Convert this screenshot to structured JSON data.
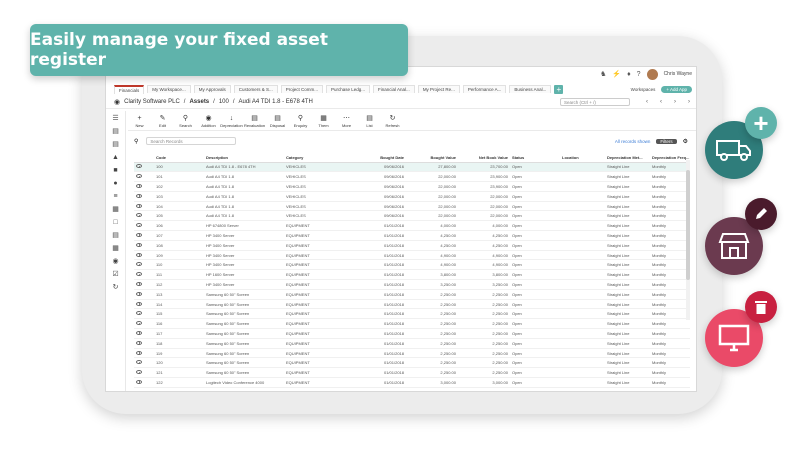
{
  "banner": {
    "text": "Easily manage your fixed asset register"
  },
  "topbar": {
    "user": "Chris Wayne"
  },
  "tabs": {
    "items": [
      "Financials",
      "My Workspace...",
      "My Approvals",
      "Customers & S...",
      "Project Comm...",
      "Purchase Ledg...",
      "Financial Anal...",
      "My Project Re...",
      "Performance A...",
      "Business Anal..."
    ],
    "workspaces": "Workspaces",
    "add_app": "+ Add App"
  },
  "breadcrumb": {
    "company": "Clarity Software PLC",
    "section": "Assets",
    "asset_code": "100",
    "asset_name": "Audi A4 TDI 1.8 - E678 4TH",
    "search_placeholder": "Search (Ctrl + /)"
  },
  "toolbar": {
    "items": [
      "New",
      "Edit",
      "Search",
      "Addition",
      "Depreciation",
      "Revaluation",
      "Disposal",
      "Enquiry",
      "Them",
      "More",
      "List",
      "Refresh"
    ]
  },
  "grid_search": {
    "placeholder": "Search Records",
    "advanced": "All records shown",
    "filter": "Filters"
  },
  "grid": {
    "headers": [
      "",
      "Code",
      "Description",
      "Category",
      "Bought Date",
      "Bought Value",
      "Net Book Value",
      "Status",
      "Location",
      "Depreciation Met...",
      "Depreciation Freq..."
    ],
    "rows": [
      {
        "code": "100",
        "desc": "Audi A4 TDI 1.8 - E678 4TH",
        "cat": "VEHICLES",
        "date": "09/06/2016",
        "value": "27,800.00",
        "nbv": "23,700.00",
        "status": "Open",
        "method": "Straight Line",
        "freq": "Monthly"
      },
      {
        "code": "101",
        "desc": "Audi A4 TDI 1.8",
        "cat": "VEHICLES",
        "date": "09/06/2016",
        "value": "22,000.00",
        "nbv": "23,900.00",
        "status": "Open",
        "method": "Straight Line",
        "freq": "Monthly"
      },
      {
        "code": "102",
        "desc": "Audi A4 TDI 1.8",
        "cat": "VEHICLES",
        "date": "09/06/2016",
        "value": "22,000.00",
        "nbv": "23,900.00",
        "status": "Open",
        "method": "Straight Line",
        "freq": "Monthly"
      },
      {
        "code": "103",
        "desc": "Audi A4 TDI 1.8",
        "cat": "VEHICLES",
        "date": "09/06/2016",
        "value": "22,000.00",
        "nbv": "22,000.00",
        "status": "Open",
        "method": "Straight Line",
        "freq": "Monthly"
      },
      {
        "code": "104",
        "desc": "Audi A4 TDI 1.8",
        "cat": "VEHICLES",
        "date": "09/06/2016",
        "value": "22,000.00",
        "nbv": "22,000.00",
        "status": "Open",
        "method": "Straight Line",
        "freq": "Monthly"
      },
      {
        "code": "105",
        "desc": "Audi A4 TDI 1.8",
        "cat": "VEHICLES",
        "date": "09/06/2016",
        "value": "22,000.00",
        "nbv": "22,000.00",
        "status": "Open",
        "method": "Straight Line",
        "freq": "Monthly"
      },
      {
        "code": "106",
        "desc": "HP 674800 Server",
        "cat": "EQUIPMENT",
        "date": "01/01/2018",
        "value": "4,000.00",
        "nbv": "4,000.00",
        "status": "Open",
        "method": "Straight Line",
        "freq": "Monthly"
      },
      {
        "code": "107",
        "desc": "HP 3400 Server",
        "cat": "EQUIPMENT",
        "date": "01/01/2018",
        "value": "4,250.00",
        "nbv": "4,250.00",
        "status": "Open",
        "method": "Straight Line",
        "freq": "Monthly"
      },
      {
        "code": "108",
        "desc": "HP 3400 Server",
        "cat": "EQUIPMENT",
        "date": "01/01/2018",
        "value": "4,250.00",
        "nbv": "4,250.00",
        "status": "Open",
        "method": "Straight Line",
        "freq": "Monthly"
      },
      {
        "code": "109",
        "desc": "HP 3400 Server",
        "cat": "EQUIPMENT",
        "date": "01/01/2018",
        "value": "4,900.00",
        "nbv": "4,900.00",
        "status": "Open",
        "method": "Straight Line",
        "freq": "Monthly"
      },
      {
        "code": "110",
        "desc": "HP 3400 Server",
        "cat": "EQUIPMENT",
        "date": "01/01/2018",
        "value": "4,900.00",
        "nbv": "4,900.00",
        "status": "Open",
        "method": "Straight Line",
        "freq": "Monthly"
      },
      {
        "code": "111",
        "desc": "HP 1600 Server",
        "cat": "EQUIPMENT",
        "date": "01/01/2018",
        "value": "3,800.00",
        "nbv": "3,800.00",
        "status": "Open",
        "method": "Straight Line",
        "freq": "Monthly"
      },
      {
        "code": "112",
        "desc": "HP 3400 Server",
        "cat": "EQUIPMENT",
        "date": "01/01/2018",
        "value": "3,250.00",
        "nbv": "3,250.00",
        "status": "Open",
        "method": "Straight Line",
        "freq": "Monthly"
      },
      {
        "code": "113",
        "desc": "Samsung 60 50\" Screen",
        "cat": "EQUIPMENT",
        "date": "01/01/2018",
        "value": "2,250.00",
        "nbv": "2,250.00",
        "status": "Open",
        "method": "Straight Line",
        "freq": "Monthly"
      },
      {
        "code": "114",
        "desc": "Samsung 60 50\" Screen",
        "cat": "EQUIPMENT",
        "date": "01/01/2018",
        "value": "2,250.00",
        "nbv": "2,250.00",
        "status": "Open",
        "method": "Straight Line",
        "freq": "Monthly"
      },
      {
        "code": "115",
        "desc": "Samsung 60 50\" Screen",
        "cat": "EQUIPMENT",
        "date": "01/01/2018",
        "value": "2,250.00",
        "nbv": "2,250.00",
        "status": "Open",
        "method": "Straight Line",
        "freq": "Monthly"
      },
      {
        "code": "116",
        "desc": "Samsung 60 50\" Screen",
        "cat": "EQUIPMENT",
        "date": "01/01/2018",
        "value": "2,250.00",
        "nbv": "2,250.00",
        "status": "Open",
        "method": "Straight Line",
        "freq": "Monthly"
      },
      {
        "code": "117",
        "desc": "Samsung 60 50\" Screen",
        "cat": "EQUIPMENT",
        "date": "01/01/2018",
        "value": "2,250.00",
        "nbv": "2,250.00",
        "status": "Open",
        "method": "Straight Line",
        "freq": "Monthly"
      },
      {
        "code": "118",
        "desc": "Samsung 60 50\" Screen",
        "cat": "EQUIPMENT",
        "date": "01/01/2018",
        "value": "2,250.00",
        "nbv": "2,250.00",
        "status": "Open",
        "method": "Straight Line",
        "freq": "Monthly"
      },
      {
        "code": "119",
        "desc": "Samsung 60 50\" Screen",
        "cat": "EQUIPMENT",
        "date": "01/01/2018",
        "value": "2,250.00",
        "nbv": "2,250.00",
        "status": "Open",
        "method": "Straight Line",
        "freq": "Monthly"
      },
      {
        "code": "120",
        "desc": "Samsung 60 50\" Screen",
        "cat": "EQUIPMENT",
        "date": "01/01/2018",
        "value": "2,250.00",
        "nbv": "2,250.00",
        "status": "Open",
        "method": "Straight Line",
        "freq": "Monthly"
      },
      {
        "code": "121",
        "desc": "Samsung 60 50\" Screen",
        "cat": "EQUIPMENT",
        "date": "01/01/2018",
        "value": "2,250.00",
        "nbv": "2,250.00",
        "status": "Open",
        "method": "Straight Line",
        "freq": "Monthly"
      },
      {
        "code": "122",
        "desc": "Logitech Video Conference 4000",
        "cat": "EQUIPMENT",
        "date": "01/01/2018",
        "value": "3,000.00",
        "nbv": "3,000.00",
        "status": "Open",
        "method": "Straight Line",
        "freq": "Monthly"
      }
    ]
  }
}
